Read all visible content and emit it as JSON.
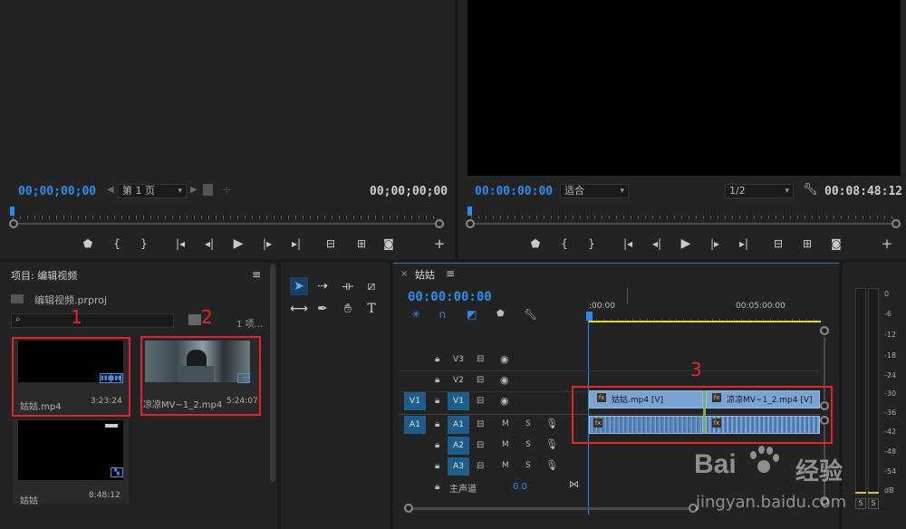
{
  "source_monitor": {
    "timecode_left": "00;00;00;00",
    "page_select": "第 1 页",
    "timecode_right": "00;00;00;00"
  },
  "program_monitor": {
    "timecode_left": "00:00:00:00",
    "fit_select": "适合",
    "resolution_select": "1/2",
    "timecode_right": "00:08:48:12"
  },
  "project": {
    "title": "项目: 编辑视频",
    "file": "编辑视频.prproj",
    "item_count": "1 项...",
    "items": [
      {
        "name": "姑姑.mp4",
        "duration": "3:23:24"
      },
      {
        "name": "凉凉MV~1_2.mp4",
        "duration": "5:24:07"
      },
      {
        "name": "姑姑",
        "duration": "8:48:12"
      }
    ]
  },
  "timeline": {
    "tab_title": "姑姑",
    "timecode": "00:00:00:00",
    "ruler_start": ":00:00",
    "ruler_mark": "00:05:00:00",
    "tracks": {
      "v3": "V3",
      "v2": "V2",
      "v1": "V1",
      "a1": "A1",
      "a2": "A2",
      "a3": "A3",
      "src_v1": "V1",
      "src_a1": "A1"
    },
    "master_label": "主声道",
    "master_value": "0.0",
    "clip_v1_a": "姑姑.mp4 [V]",
    "clip_v1_b": "凉凉MV~1_2.mp4 [V]",
    "fx": "fx"
  },
  "meter": {
    "scale": [
      "0",
      "-6",
      "-12",
      "-18",
      "-24",
      "-30",
      "-36",
      "-42",
      "-48",
      "-54",
      "dB"
    ],
    "solo_left": "S",
    "solo_right": "S"
  },
  "annotations": {
    "label1": "1",
    "label2": "2",
    "label3": "3"
  },
  "watermark": {
    "brand": "Bai",
    "brand_cn": "经验",
    "url": "jingyan.baidu.com"
  },
  "colors": {
    "accent_blue": "#2d8ceb",
    "clip_blue": "#7aa4d4",
    "annotation_red": "#e0262a"
  }
}
